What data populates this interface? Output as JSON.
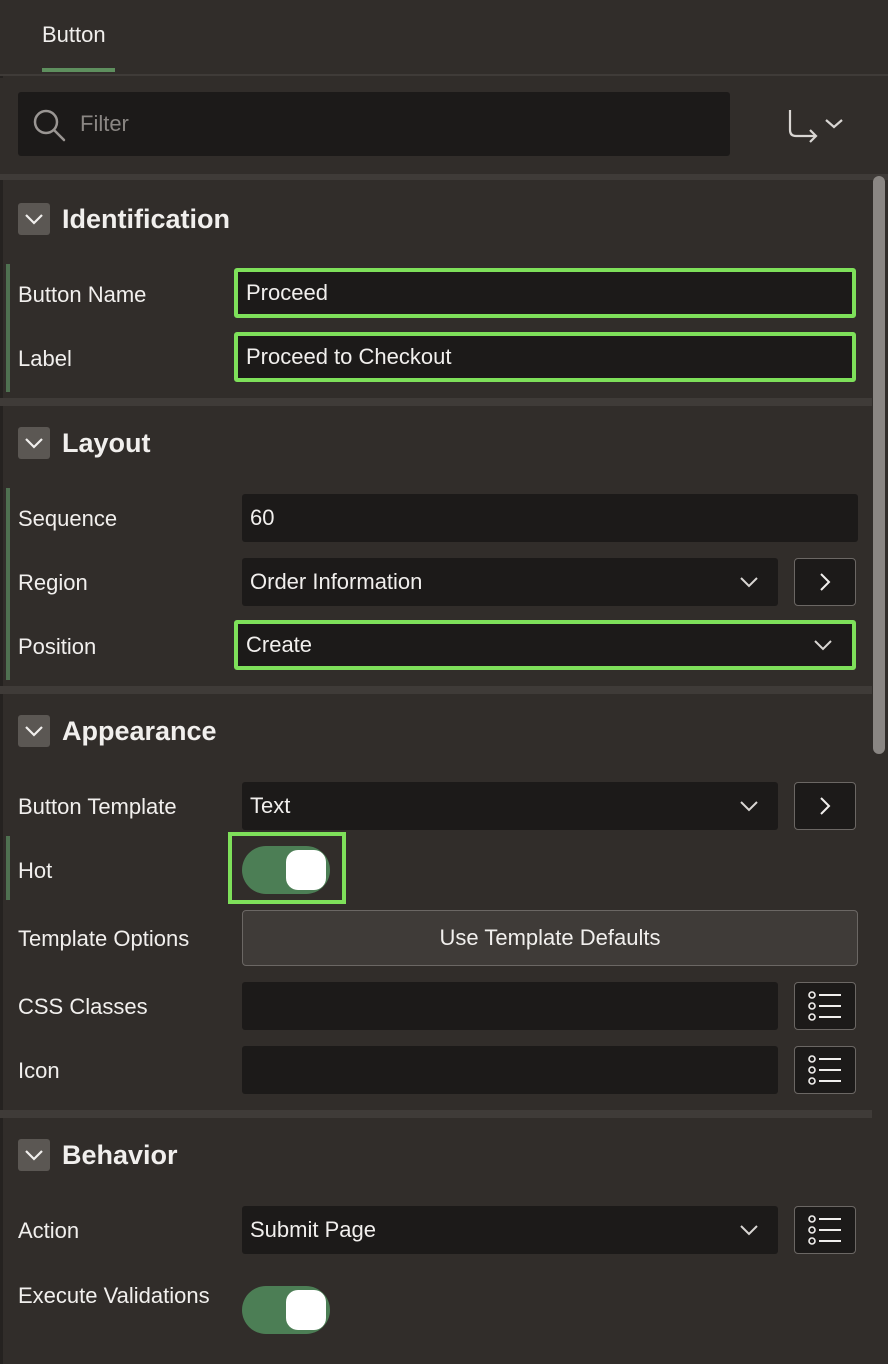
{
  "tabs": [
    {
      "label": "Button"
    }
  ],
  "filter": {
    "placeholder": "Filter"
  },
  "sections": {
    "identification": {
      "title": "Identification",
      "button_name": {
        "label": "Button Name",
        "value": "Proceed"
      },
      "label": {
        "label": "Label",
        "value": "Proceed to Checkout"
      }
    },
    "layout": {
      "title": "Layout",
      "sequence": {
        "label": "Sequence",
        "value": "60"
      },
      "region": {
        "label": "Region",
        "value": "Order Information"
      },
      "position": {
        "label": "Position",
        "value": "Create"
      }
    },
    "appearance": {
      "title": "Appearance",
      "button_template": {
        "label": "Button Template",
        "value": "Text"
      },
      "hot": {
        "label": "Hot",
        "value": true
      },
      "template_options": {
        "label": "Template Options",
        "button": "Use Template Defaults"
      },
      "css_classes": {
        "label": "CSS Classes",
        "value": ""
      },
      "icon": {
        "label": "Icon",
        "value": ""
      }
    },
    "behavior": {
      "title": "Behavior",
      "action": {
        "label": "Action",
        "value": "Submit Page"
      },
      "execute_validations": {
        "label": "Execute Validations",
        "value": true
      }
    }
  },
  "colors": {
    "background": "#312d2a",
    "field": "#1c1a19",
    "highlight": "#7ee05a",
    "toggle_on": "#4c7e55",
    "changed_marker": "#4f7151"
  }
}
